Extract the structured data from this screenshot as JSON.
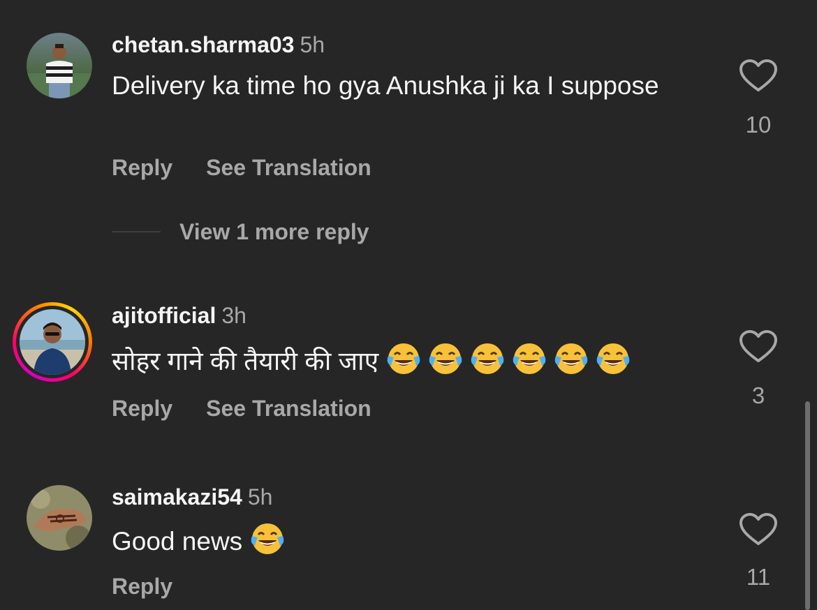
{
  "comments": [
    {
      "username": "chetan.sharma03",
      "time": "5h",
      "text": "Delivery ka time ho gya Anushka ji ka  I suppose",
      "reply_label": "Reply",
      "translate_label": "See Translation",
      "likes": "10",
      "avatar_icon": "profile-photo"
    },
    {
      "username": "ajitofficial",
      "time": "3h",
      "text": "सोहर गाने की तैयारी की जाए",
      "emoji": "😂😂😂😂😂😂",
      "reply_label": "Reply",
      "translate_label": "See Translation",
      "likes": "3",
      "avatar_icon": "profile-photo-story-ring"
    },
    {
      "username": "saimakazi54",
      "time": "5h",
      "text": "Good news",
      "emoji": "😂",
      "reply_label": "Reply",
      "likes": "11",
      "avatar_icon": "profile-photo"
    }
  ],
  "view_more_replies": "View 1 more reply",
  "icons": {
    "like": "heart-outline-icon",
    "emoji": "face-with-tears-of-joy"
  },
  "colors": {
    "background": "#262626",
    "primary_text": "#f5f5f5",
    "secondary_text": "#a8a8a8",
    "story_ring": [
      "#d300c5",
      "#ff0069",
      "#ff7a00",
      "#ffd600"
    ]
  }
}
